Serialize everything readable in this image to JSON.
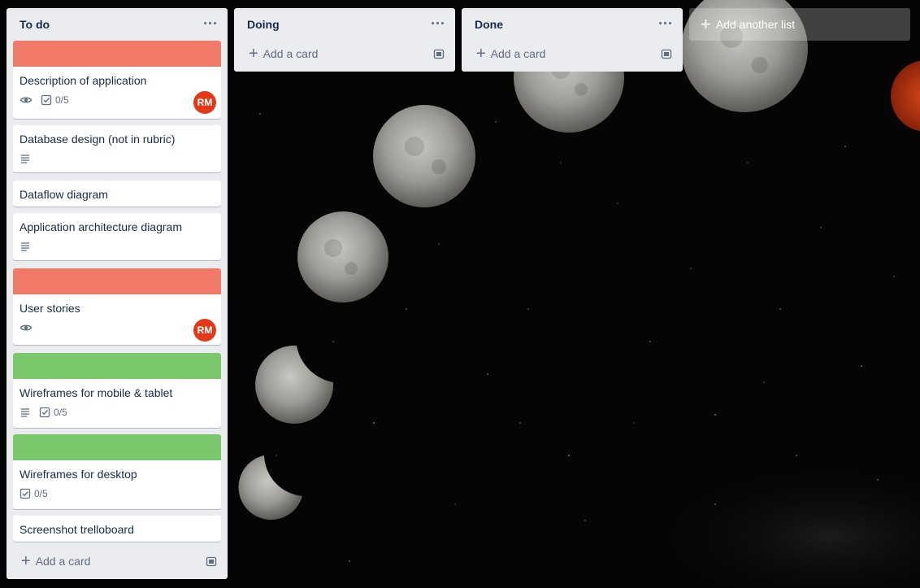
{
  "board": {
    "lists": [
      {
        "title": "To do",
        "add_card_label": "Add a card",
        "cards": [
          {
            "cover_color": "#f07a67",
            "title": "Description of application",
            "badges": {
              "watch": true,
              "checklist": "0/5"
            },
            "member": "RM"
          },
          {
            "title": "Database design (not in rubric)",
            "badges": {
              "description": true
            }
          },
          {
            "title": "Dataflow diagram"
          },
          {
            "title": "Application architecture diagram",
            "badges": {
              "description": true
            }
          },
          {
            "cover_color": "#f07a67",
            "title": "User stories",
            "badges": {
              "watch": true
            },
            "member": "RM"
          },
          {
            "cover_color": "#7bc86c",
            "title": "Wireframes for mobile & tablet",
            "badges": {
              "description": true,
              "checklist": "0/5"
            }
          },
          {
            "cover_color": "#7bc86c",
            "title": "Wireframes for desktop",
            "badges": {
              "checklist": "0/5"
            }
          },
          {
            "title": "Screenshot trelloboard"
          }
        ]
      },
      {
        "title": "Doing",
        "add_card_label": "Add a card"
      },
      {
        "title": "Done",
        "add_card_label": "Add a card"
      }
    ],
    "add_list_label": "Add another list"
  },
  "icons": {
    "list_menu": "more-horizontal-icon",
    "add": "plus-icon",
    "template": "card-template-icon",
    "watch": "eye-icon",
    "checklist": "checkbox-icon",
    "description": "description-lines-icon"
  },
  "colors": {
    "list_bg": "#ebecf0",
    "cover_red": "#f07a67",
    "cover_green": "#7bc86c",
    "avatar": "#e2391b",
    "text_muted": "#5e6c84"
  }
}
